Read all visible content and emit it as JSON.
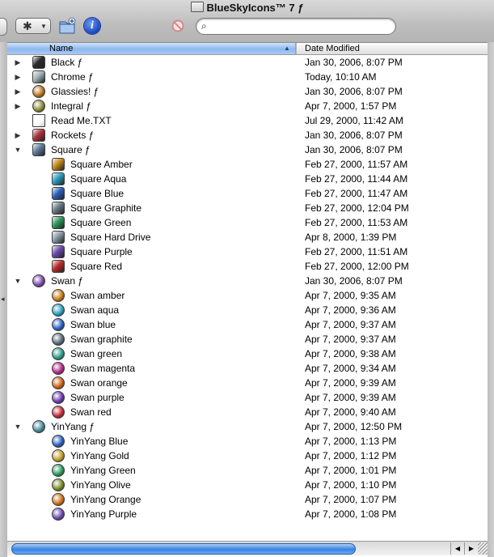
{
  "window": {
    "title": "BlueSkyIcons™ 7 ƒ",
    "search_value": ""
  },
  "icons": {
    "title_folder": "folder-icon",
    "action": "gear-icon",
    "action_menu": "chevron-down-icon",
    "new_folder": "new-folder-icon",
    "info": "info-icon",
    "stop": "no-sign-icon",
    "search": "magnifier-icon",
    "sort": "sort-up-arrow-icon"
  },
  "glyphs": {
    "gear": "✱",
    "menu": "▼",
    "info": "i",
    "search": "⌕",
    "sort_up": "▲",
    "scroll_left": "◀",
    "scroll_right": "▶"
  },
  "columns": {
    "name": "Name",
    "date": "Date Modified"
  },
  "rows": [
    {
      "name": "Black ƒ",
      "date": "Jan 30, 2006, 8:07 PM",
      "disclosure": "▶",
      "color": "#2a2a2a",
      "shape": "square"
    },
    {
      "name": "Chrome ƒ",
      "date": "Today, 10:10 AM",
      "disclosure": "▶",
      "color": "#9fb4b8",
      "shape": "square"
    },
    {
      "name": "Glassies! ƒ",
      "date": "Jan 30, 2006, 8:07 PM",
      "disclosure": "▶",
      "color": "#b8731e",
      "shape": "round"
    },
    {
      "name": "Integral ƒ",
      "date": "Apr 7, 2000, 1:57 PM",
      "disclosure": "▶",
      "color": "#8a8a3a",
      "shape": "round"
    },
    {
      "name": "Read Me.TXT",
      "date": "Jul 29, 2000, 11:42 AM",
      "disclosure": "",
      "color": "#f0f0f0",
      "shape": "doc"
    },
    {
      "name": "Rockets ƒ",
      "date": "Jan 30, 2006, 8:07 PM",
      "disclosure": "▶",
      "color": "#b0303a",
      "shape": "square"
    },
    {
      "name": "Square ƒ",
      "date": "Jan 30, 2006, 8:07 PM",
      "disclosure": "▼",
      "color": "#5f7a9a",
      "shape": "square"
    },
    {
      "name": "Square Amber",
      "date": "Feb 27, 2000, 11:57 AM",
      "disclosure": "",
      "color": "#c98a1a",
      "shape": "square"
    },
    {
      "name": "Square Aqua",
      "date": "Feb 27, 2000, 11:44 AM",
      "disclosure": "",
      "color": "#2aa0c0",
      "shape": "square"
    },
    {
      "name": "Square Blue",
      "date": "Feb 27, 2000, 11:47 AM",
      "disclosure": "",
      "color": "#2a5fc0",
      "shape": "square"
    },
    {
      "name": "Square Graphite",
      "date": "Feb 27, 2000, 12:04 PM",
      "disclosure": "",
      "color": "#6a7b8a",
      "shape": "square"
    },
    {
      "name": "Square Green",
      "date": "Feb 27, 2000, 11:53 AM",
      "disclosure": "",
      "color": "#2a9a5a",
      "shape": "square"
    },
    {
      "name": "Square Hard Drive",
      "date": "Apr 8, 2000, 1:39 PM",
      "disclosure": "",
      "color": "#8a9aaa",
      "shape": "square"
    },
    {
      "name": "Square Purple",
      "date": "Feb 27, 2000, 11:51 AM",
      "disclosure": "",
      "color": "#6a4ab0",
      "shape": "square"
    },
    {
      "name": "Square Red",
      "date": "Feb 27, 2000, 12:00 PM",
      "disclosure": "",
      "color": "#c02a2a",
      "shape": "square"
    },
    {
      "name": "Swan ƒ",
      "date": "Jan 30, 2006, 8:07 PM",
      "disclosure": "▼",
      "color": "#7a4ab0",
      "shape": "round"
    },
    {
      "name": "Swan amber",
      "date": "Apr 7, 2000, 9:35 AM",
      "disclosure": "",
      "color": "#c97a1a",
      "shape": "round"
    },
    {
      "name": "Swan aqua",
      "date": "Apr 7, 2000, 9:36 AM",
      "disclosure": "",
      "color": "#2aa0c0",
      "shape": "round"
    },
    {
      "name": "Swan blue",
      "date": "Apr 7, 2000, 9:37 AM",
      "disclosure": "",
      "color": "#2a5fc0",
      "shape": "round"
    },
    {
      "name": "Swan graphite",
      "date": "Apr 7, 2000, 9:37 AM",
      "disclosure": "",
      "color": "#5a6a7a",
      "shape": "round"
    },
    {
      "name": "Swan green",
      "date": "Apr 7, 2000, 9:38 AM",
      "disclosure": "",
      "color": "#2a9a8a",
      "shape": "round"
    },
    {
      "name": "Swan magenta",
      "date": "Apr 7, 2000, 9:34 AM",
      "disclosure": "",
      "color": "#b02a8a",
      "shape": "round"
    },
    {
      "name": "Swan orange",
      "date": "Apr 7, 2000, 9:39 AM",
      "disclosure": "",
      "color": "#d0601a",
      "shape": "round"
    },
    {
      "name": "Swan purple",
      "date": "Apr 7, 2000, 9:39 AM",
      "disclosure": "",
      "color": "#6a3ab0",
      "shape": "round"
    },
    {
      "name": "Swan red",
      "date": "Apr 7, 2000, 9:40 AM",
      "disclosure": "",
      "color": "#c02a3a",
      "shape": "round"
    },
    {
      "name": "YinYang ƒ",
      "date": "Apr 7, 2000, 12:50 PM",
      "disclosure": "▼",
      "color": "#4a8a9a",
      "shape": "round"
    },
    {
      "name": "YinYang Blue",
      "date": "Apr 7, 2000, 1:13 PM",
      "disclosure": "",
      "color": "#2a5fc0",
      "shape": "round"
    },
    {
      "name": "YinYang Gold",
      "date": "Apr 7, 2000, 1:12 PM",
      "disclosure": "",
      "color": "#c0a02a",
      "shape": "round"
    },
    {
      "name": "YinYang Green",
      "date": "Apr 7, 2000, 1:01 PM",
      "disclosure": "",
      "color": "#2a9a5a",
      "shape": "round"
    },
    {
      "name": "YinYang Olive",
      "date": "Apr 7, 2000, 1:10 PM",
      "disclosure": "",
      "color": "#7a8a2a",
      "shape": "round"
    },
    {
      "name": "YinYang Orange",
      "date": "Apr 7, 2000, 1:07 PM",
      "disclosure": "",
      "color": "#d0701a",
      "shape": "round"
    },
    {
      "name": "YinYang Purple",
      "date": "Apr 7, 2000, 1:08 PM",
      "disclosure": "",
      "color": "#6a4ab0",
      "shape": "round"
    }
  ]
}
